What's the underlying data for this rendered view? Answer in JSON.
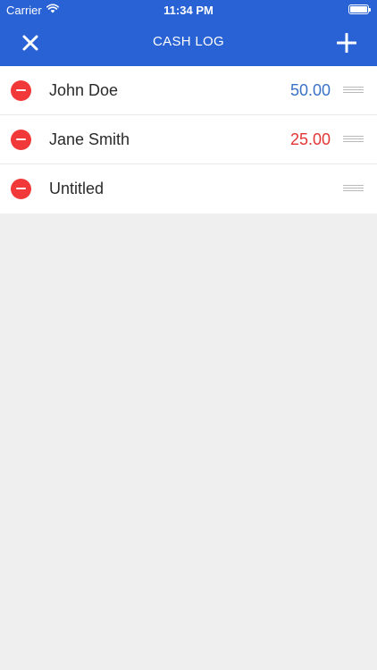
{
  "status_bar": {
    "carrier": "Carrier",
    "time": "11:34 PM",
    "wifi_icon": "wifi-icon",
    "battery_icon": "battery-icon"
  },
  "nav": {
    "title": "CASH LOG",
    "close_icon": "close-icon",
    "add_icon": "plus-icon"
  },
  "colors": {
    "header": "#2962d4",
    "positive": "#3a72c6",
    "negative": "#e33535",
    "delete": "#f2393a"
  },
  "entries": [
    {
      "name": "John Doe",
      "amount": "50.00",
      "type": "positive"
    },
    {
      "name": "Jane Smith",
      "amount": "25.00",
      "type": "negative"
    },
    {
      "name": "Untitled",
      "amount": "",
      "type": "none"
    }
  ]
}
